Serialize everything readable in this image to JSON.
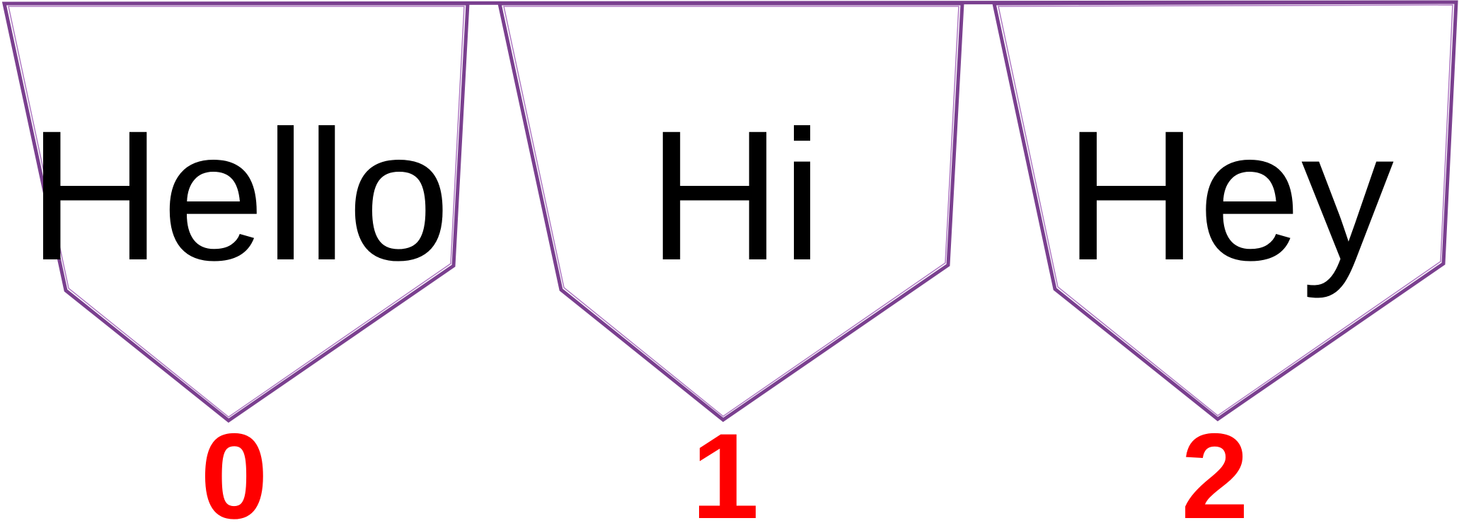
{
  "colors": {
    "outline": "#7a3f8f",
    "word": "#000000",
    "index": "#ff0000",
    "background": "#ffffff"
  },
  "flags": [
    {
      "word": "Hello",
      "index": "0"
    },
    {
      "word": "Hi",
      "index": "1"
    },
    {
      "word": "Hey",
      "index": "2"
    }
  ]
}
